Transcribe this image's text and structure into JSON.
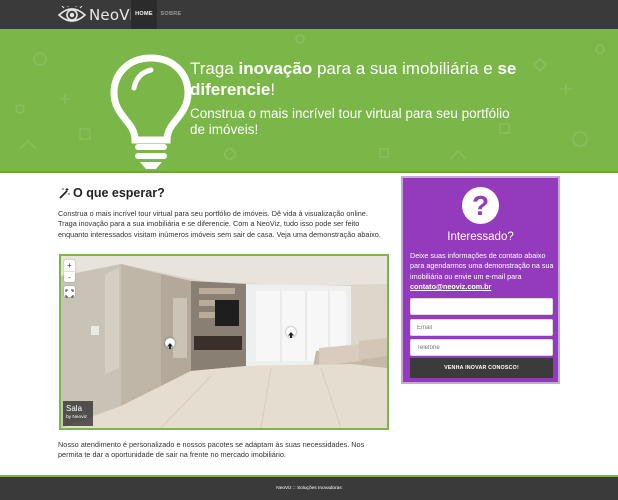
{
  "brand": {
    "name": "NeoViz",
    "icon": "eye-icon"
  },
  "nav": {
    "items": [
      {
        "label": "HOME",
        "active": true
      },
      {
        "label": "SOBRE",
        "active": false
      }
    ]
  },
  "hero": {
    "title_part1": "Traga ",
    "title_bold1": "inovação",
    "title_part2": " para a sua imobiliária e ",
    "title_bold2": "se diferencie",
    "title_part3": "!",
    "subtitle": "Construa o mais incrível tour virtual para seu portfólio de imóveis!",
    "icon": "lightbulb-icon",
    "background_color": "#7ab648"
  },
  "main": {
    "section_title": "O que esperar?",
    "section_icon": "magic-wand-icon",
    "intro": "Construa o mais incrível tour virtual para seu portfólio de imóveis. Dê vida à visualização online. Traga inovação para a sua imobiliária e se diferencie. Com a NeoViz, tudo isso pode ser feito enquanto interessados visitam inúmeros imóveis sem sair de casa. Veja uma demonstração abaixo.",
    "tour": {
      "zoom_in": "+",
      "zoom_out": "-",
      "scene_name": "Sala",
      "scene_author": "by Neoviz"
    },
    "closing": "Nosso atendimento é personalizado e nossos pacotes se adaptam às suas necessidades. Nos permita te dar a oportunidade de sair na frente no mercado imobiliário."
  },
  "sidebar": {
    "icon": "question-mark-icon",
    "mark": "?",
    "title": "Interessado?",
    "text": "Deixe suas informações de contato abaixo para agendarmos uma demonstração na sua imobiliária ou envie um e-mail para ",
    "email": "contato@neoviz.com.br",
    "name_placeholder": "",
    "email_placeholder": "Email",
    "phone_placeholder": "Telefone",
    "submit_label": "VENHA INOVAR CONOSCO!",
    "background_color": "#943bbd"
  },
  "footer": {
    "text": "NeoViz :: Soluções Inovadoras"
  }
}
